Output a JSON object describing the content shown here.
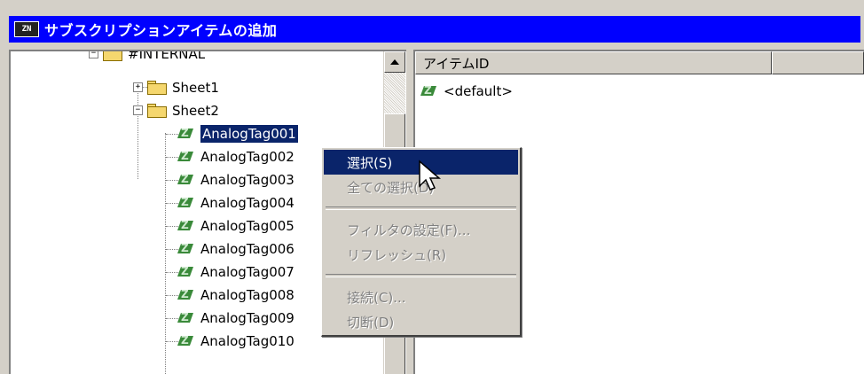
{
  "window": {
    "title": "サブスクリプションアイテムの追加",
    "icon": "app-icon",
    "icon_text": "ZN"
  },
  "tree": {
    "root": {
      "label": "#INTERNAL",
      "expander": "−"
    },
    "sheet1": {
      "label": "Sheet1",
      "expander": "+"
    },
    "sheet2": {
      "label": "Sheet2",
      "expander": "−"
    },
    "tags": [
      "AnalogTag001",
      "AnalogTag002",
      "AnalogTag003",
      "AnalogTag004",
      "AnalogTag005",
      "AnalogTag006",
      "AnalogTag007",
      "AnalogTag008",
      "AnalogTag009",
      "AnalogTag010"
    ],
    "selected_index": 0
  },
  "list": {
    "columns": [
      "アイテムID",
      ""
    ],
    "items": [
      "<default>"
    ]
  },
  "context_menu": {
    "items": [
      {
        "label": "選択(S)",
        "enabled": true,
        "highlighted": true
      },
      {
        "label": "全ての選択(D)",
        "enabled": false
      },
      {
        "label": "フィルタの設定(F)...",
        "enabled": false
      },
      {
        "label": "リフレッシュ(R)",
        "enabled": false
      },
      {
        "label": "接続(C)...",
        "enabled": false
      },
      {
        "label": "切断(D)",
        "enabled": false
      }
    ]
  },
  "colors": {
    "titlebar": "#0000ff",
    "selection": "#0a246a",
    "face": "#d4d0c8",
    "tag_icon": "#3a8a3a",
    "folder": "#f5d76e"
  }
}
